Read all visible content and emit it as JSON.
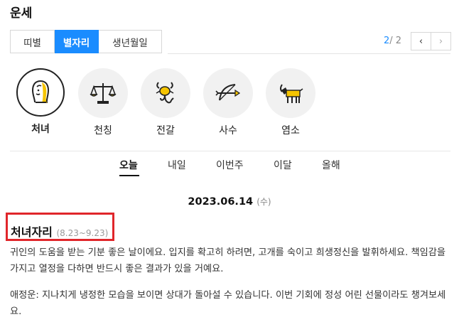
{
  "header": {
    "title": "운세"
  },
  "tabs": [
    {
      "label": "띠별",
      "active": false
    },
    {
      "label": "별자리",
      "active": true
    },
    {
      "label": "생년월일",
      "active": false
    }
  ],
  "pager": {
    "current": "2",
    "separator": "/ ",
    "total": "2",
    "prev_icon": "‹",
    "next_icon": "›"
  },
  "signs": [
    {
      "label": "처녀",
      "icon": "virgo-icon",
      "selected": true
    },
    {
      "label": "천칭",
      "icon": "libra-icon",
      "selected": false
    },
    {
      "label": "전갈",
      "icon": "scorpio-icon",
      "selected": false
    },
    {
      "label": "사수",
      "icon": "sagittarius-icon",
      "selected": false
    },
    {
      "label": "염소",
      "icon": "capricorn-icon",
      "selected": false
    }
  ],
  "periods": [
    {
      "label": "오늘",
      "active": true
    },
    {
      "label": "내일",
      "active": false
    },
    {
      "label": "이번주",
      "active": false
    },
    {
      "label": "이달",
      "active": false
    },
    {
      "label": "올해",
      "active": false
    }
  ],
  "fortune": {
    "date": "2023.06.14",
    "day_of_week": "(수)",
    "sign_name": "처녀자리",
    "sign_range": "(8.23~9.23)",
    "paragraph1": "귀인의 도움을 받는 기분 좋은 날이에요. 입지를 확고히 하려면, 고개를 숙이고 희생정신을 발휘하세요. 책임감을 가지고 열정을 다하면 반드시 좋은 결과가 있을 거예요.",
    "paragraph2": "애정운: 지나치게 냉정한 모습을 보이면 상대가 돌아설 수 있습니다. 이번 기회에 정성 어린 선물이라도 챙겨보세요."
  },
  "colors": {
    "accent": "#1a8cff",
    "highlight": "#e0262b",
    "icon_yellow": "#f5c400"
  }
}
